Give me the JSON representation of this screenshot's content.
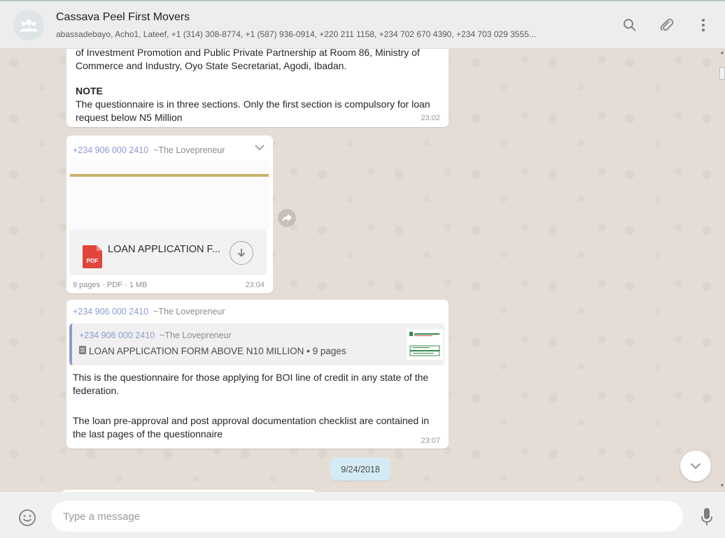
{
  "header": {
    "title": "Cassava Peel First Movers",
    "members": "abassadebayo, Acho1, Lateef, +1 (314) 308-8774, +1 (587) 936-0914, +220 211 1158, +234 702 670 4390, +234 703 029 3555..."
  },
  "messages": {
    "m1": {
      "text": "of Investment Promotion and Public Private Partnership at Room 86, Ministry of Commerce and Industry, Oyo State Secretariat, Agodi, Ibadan.",
      "note_title": "NOTE",
      "note_text": "The questionnaire is in three sections. Only the first section is compulsory for loan request below N5 Million",
      "time": "23:02"
    },
    "m2": {
      "sender_phone": "+234 906 000 2410",
      "sender_nick": "~The Lovepreneur",
      "file_icon": "PDF",
      "file_name": "LOAN APPLICATION F...",
      "meta": "9 pages · PDF · 1 MB",
      "time": "23:04"
    },
    "m3": {
      "sender_phone": "+234 906 000 2410",
      "sender_nick": "~The Lovepreneur",
      "quote_phone": "+234 906 000 2410",
      "quote_nick": "~The Lovepreneur",
      "quote_doc": "LOAN APPLICATION FORM ABOVE N10 MILLION • 9 pages",
      "body1": "This is the questionnaire for those applying for BOI line of credit in any state of the federation.",
      "body2": "The loan pre-approval and post approval documentation checklist are contained in the last pages of the questionnaire",
      "time": "23:07"
    }
  },
  "date_separator": "9/24/2018",
  "composer": {
    "placeholder": "Type a message"
  },
  "colors": {
    "accent_sender": "#8e9ad1",
    "date_pill": "#d4eaf4",
    "pdf_red": "#e0463c"
  },
  "icons": [
    "group-avatar-icon",
    "search-icon",
    "attach-icon",
    "menu-icon",
    "chevron-down-icon",
    "pdf-icon",
    "download-icon",
    "forward-icon",
    "document-icon",
    "emoji-icon",
    "mic-icon"
  ]
}
